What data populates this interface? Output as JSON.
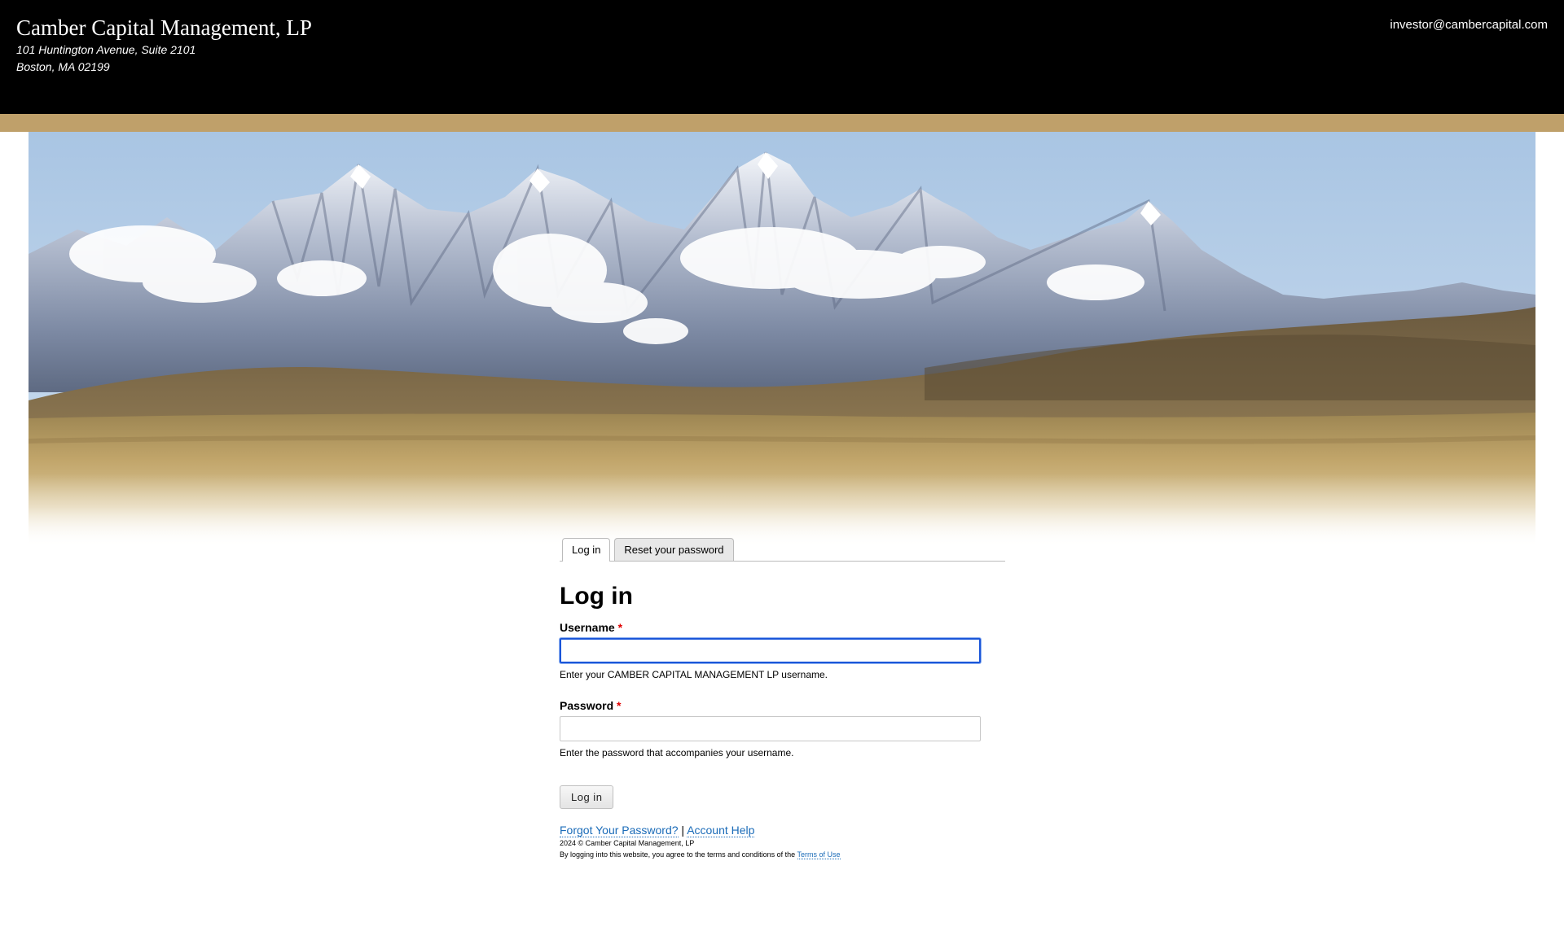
{
  "header": {
    "firm_name": "Camber Capital Management, LP",
    "address_line1": "101 Huntington Avenue, Suite 2101",
    "address_line2": "Boston, MA 02199",
    "email": "investor@cambercapital.com"
  },
  "colors": {
    "header_bg": "#000000",
    "gold_band": "#bfa06a",
    "link": "#1a6bb8",
    "required": "#e00000",
    "focus_border": "#1a56d9"
  },
  "tabs": [
    {
      "label": "Log in",
      "active": true
    },
    {
      "label": "Reset your password",
      "active": false
    }
  ],
  "login": {
    "title": "Log in",
    "username_label": "Username",
    "username_value": "",
    "username_desc": "Enter your CAMBER CAPITAL MANAGEMENT LP username.",
    "password_label": "Password",
    "password_value": "",
    "password_desc": "Enter the password that accompanies your username.",
    "required_marker": "*",
    "submit_label": "Log in"
  },
  "footer": {
    "forgot_link": "Forgot Your Password?",
    "separator": "|",
    "help_link": "Account Help",
    "copyright": "2024 © Camber Capital Management, LP",
    "terms_text": "By logging into this website, you agree to the terms and conditions of the",
    "terms_link": "Terms of Use"
  }
}
